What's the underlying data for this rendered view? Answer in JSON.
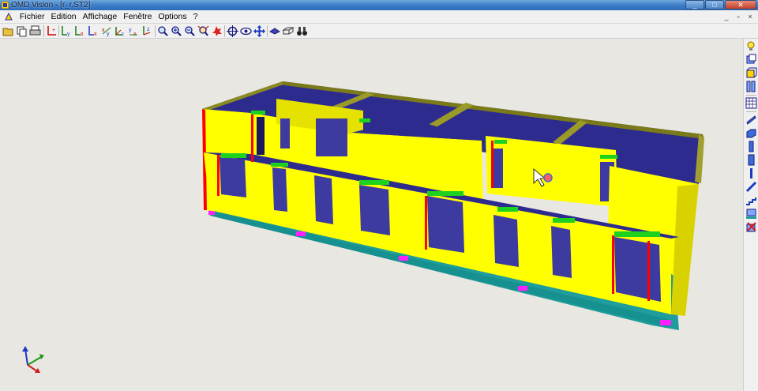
{
  "window": {
    "title": "OMD Vision - [r_r.ST2]",
    "buttons": {
      "minimize": "_",
      "maximize": "□",
      "close": "✕"
    }
  },
  "menubar": {
    "items": [
      "Fichier",
      "Edition",
      "Affichage",
      "Fenêtre",
      "Options",
      "?"
    ],
    "mdi_buttons": {
      "minimize": "_",
      "restore": "▫",
      "close": "×"
    }
  },
  "toolbar": {
    "buttons": [
      {
        "name": "open-icon"
      },
      {
        "name": "copy-icon"
      },
      {
        "name": "print-icon"
      },
      {
        "name": "axis-icon"
      },
      {
        "name": "view-zy-icon"
      },
      {
        "name": "view-zx-icon"
      },
      {
        "name": "view-xy-icon"
      },
      {
        "name": "view-yx-icon"
      },
      {
        "name": "view-xyz-icon"
      },
      {
        "name": "view-yz-icon"
      },
      {
        "name": "view-zyx-icon"
      },
      {
        "name": "zoom-window-icon"
      },
      {
        "name": "zoom-in-icon"
      },
      {
        "name": "zoom-out-icon"
      },
      {
        "name": "zoom-extents-icon"
      },
      {
        "name": "explode-icon"
      },
      {
        "name": "target-icon"
      },
      {
        "name": "eye-icon"
      },
      {
        "name": "pan-icon"
      },
      {
        "name": "rotate-icon"
      },
      {
        "name": "wireframe-icon"
      },
      {
        "name": "binoculars-icon"
      }
    ]
  },
  "palette": {
    "buttons": [
      {
        "name": "light-bulb-icon"
      },
      {
        "name": "layers-icon"
      },
      {
        "name": "cube-icon"
      },
      {
        "name": "panels-icon"
      },
      {
        "name": "grid-icon"
      },
      {
        "name": "beam-icon"
      },
      {
        "name": "slab-icon"
      },
      {
        "name": "column-icon"
      },
      {
        "name": "wall-icon"
      },
      {
        "name": "pillar-icon"
      },
      {
        "name": "brace-icon"
      },
      {
        "name": "stair-icon"
      },
      {
        "name": "foundation-icon"
      },
      {
        "name": "delete-element-icon"
      }
    ]
  },
  "colors": {
    "wall": "#ffff00",
    "wall_shade": "#d8d200",
    "slab_top": "#2e2b8e",
    "opening_interior": "#3d3aa0",
    "lintel": "#1fd11f",
    "wall_edge": "#ff0000",
    "foundation": "#1f9c9c",
    "support": "#ff20ff",
    "background": "#e9e7e2"
  }
}
